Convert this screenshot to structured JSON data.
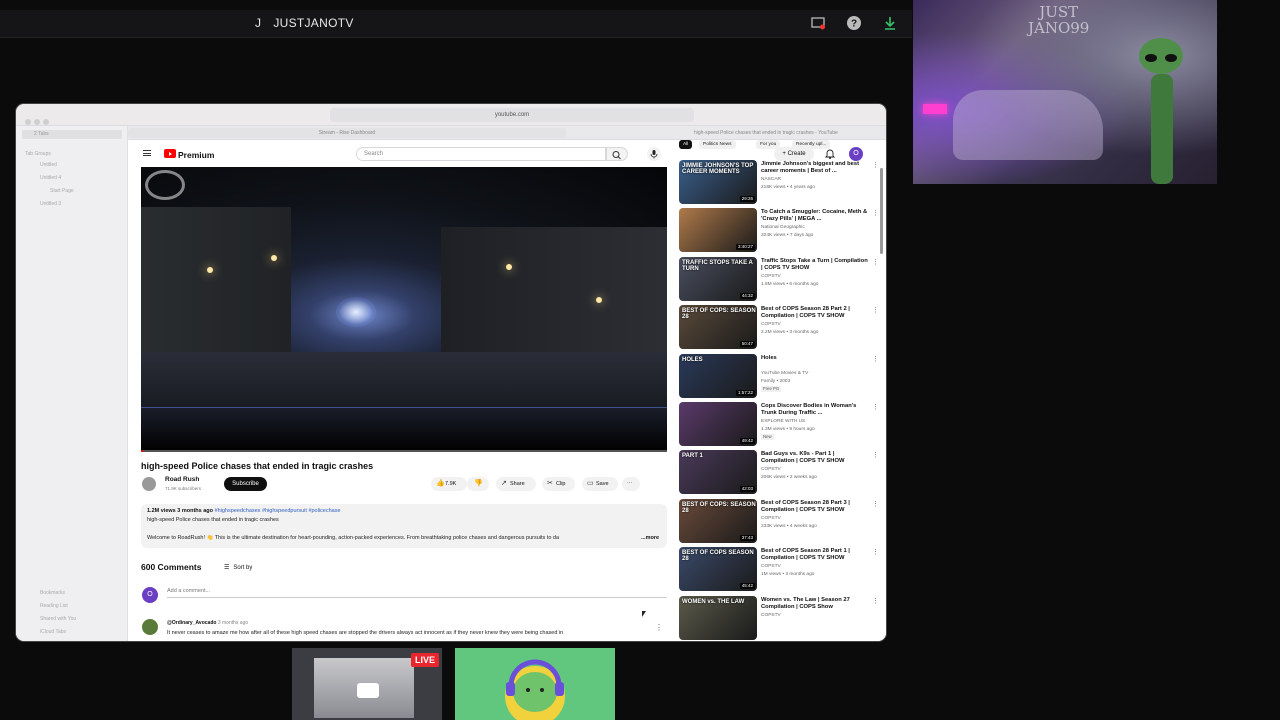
{
  "stream": {
    "initial": "J",
    "title": "JUSTJANOTV",
    "cam_logo": "JUST\nJANO99",
    "live_label": "LIVE"
  },
  "browser": {
    "url": "youtube.com",
    "tab_active": "Stream - Rise Dashboard",
    "tab_other": "high-speed Police chases that ended in tragic crashes - YouTube",
    "sidebar": {
      "selected": "2 Tabs",
      "group_header": "Tab Groups",
      "items": [
        "Untitled",
        "Untitled 4",
        "Start Page",
        "Untitled 3"
      ],
      "bottom": [
        "Bookmarks",
        "Reading List",
        "Shared with You",
        "iCloud Tabs"
      ]
    }
  },
  "youtube": {
    "brand": "Premium",
    "search_placeholder": "Search",
    "create_label": "Create",
    "avatar_initial": "O",
    "video": {
      "title": "high-speed Police chases that ended in tragic crashes",
      "channel": "Road Rush",
      "subscribers": "71.9K subscribers",
      "subscribe_label": "Subscribe",
      "likes": "7.9K",
      "share_label": "Share",
      "clip_label": "Clip",
      "save_label": "Save",
      "views_date": "1.2M views  3 months ago",
      "hashtags": "#highspeedchases #highspeedpursuit #policechase",
      "desc_line": "high-speed Police chases that ended in tragic crashes",
      "desc_body": "Welcome to RoadRush! 👋 This is the ultimate destination for heart-pounding, action-packed experiences. From breathtaking police chases and dangerous pursuits to da",
      "more_label": "...more"
    },
    "comments": {
      "count": "600 Comments",
      "sort_label": "Sort by",
      "add_placeholder": "Add a comment...",
      "first_user": "@Ordinary_Avocado",
      "first_time": "3 months ago",
      "first_text": "It never ceases to amaze me how after all of these high speed chases are stopped the drivers always act innocent as if they never knew they were being chased in"
    },
    "chips": [
      "All",
      "Politics News",
      "For you",
      "Recently upl..."
    ],
    "recommendations": [
      {
        "title": "Jimmie Johnson's biggest and best career moments | Best of ...",
        "channel": "NASCAR",
        "meta": "218K views • 4 years ago",
        "duration": "29:26",
        "badge": "",
        "thumb_caption": "JIMMIE JOHNSON'S TOP CAREER MOMENTS",
        "color": "#3a5f8c"
      },
      {
        "title": "To Catch a Smuggler: Cocaine, Meth & 'Crazy Pills' | MEGA ...",
        "channel": "National Geographic",
        "meta": "324K views • 7 days ago",
        "duration": "3:40:27",
        "badge": "",
        "thumb_caption": "",
        "color": "#b07a4a"
      },
      {
        "title": "Traffic Stops Take a Turn | Compilation | COPS TV SHOW",
        "channel": "COPSTV",
        "meta": "1.8M views • 6 months ago",
        "duration": "44:32",
        "badge": "",
        "thumb_caption": "TRAFFIC STOPS TAKE A TURN",
        "color": "#4a4f60"
      },
      {
        "title": "Best of COPS Season 28 Part 2 | Compilation | COPS TV SHOW",
        "channel": "COPSTV",
        "meta": "2.2M views • 3 months ago",
        "duration": "50:47",
        "badge": "",
        "thumb_caption": "BEST OF COPS: SEASON 28",
        "color": "#5a4a3a"
      },
      {
        "title": "Holes",
        "channel": "YouTube Movies & TV",
        "meta": "Family • 2003",
        "duration": "1:57:22",
        "badge": "Free  PG",
        "thumb_caption": "HOLES",
        "color": "#2a3a5a"
      },
      {
        "title": "Cops Discover Bodies in Woman's Trunk During Traffic ...",
        "channel": "EXPLORE WITH US",
        "meta": "1.3M views • 9 hours ago",
        "duration": "49:42",
        "badge": "New",
        "thumb_caption": "",
        "color": "#5a3a6a"
      },
      {
        "title": "Bad Guys vs. K9s - Part 1 | Compilation | COPS TV SHOW",
        "channel": "COPSTV",
        "meta": "206K views • 2 weeks ago",
        "duration": "42:03",
        "badge": "",
        "thumb_caption": "PART 1",
        "color": "#4a3a5a"
      },
      {
        "title": "Best of COPS Season 28 Part 3 | Compilation | COPS TV SHOW",
        "channel": "COPSTV",
        "meta": "233K views • 4 weeks ago",
        "duration": "37:43",
        "badge": "",
        "thumb_caption": "BEST OF COPS: SEASON 28",
        "color": "#6a4a3a"
      },
      {
        "title": "Best of COPS Season 28 Part 1 | Compilation | COPS TV SHOW",
        "channel": "COPSTV",
        "meta": "1M views • 3 months ago",
        "duration": "45:42",
        "badge": "",
        "thumb_caption": "BEST OF COPS SEASON 28",
        "color": "#3a4a6a"
      },
      {
        "title": "Women vs. The Law | Season 27 Compilation | COPS Show",
        "channel": "COPSTV",
        "meta": "",
        "duration": "",
        "badge": "",
        "thumb_caption": "WOMEN vs. THE LAW",
        "color": "#5a5a4a"
      }
    ]
  }
}
